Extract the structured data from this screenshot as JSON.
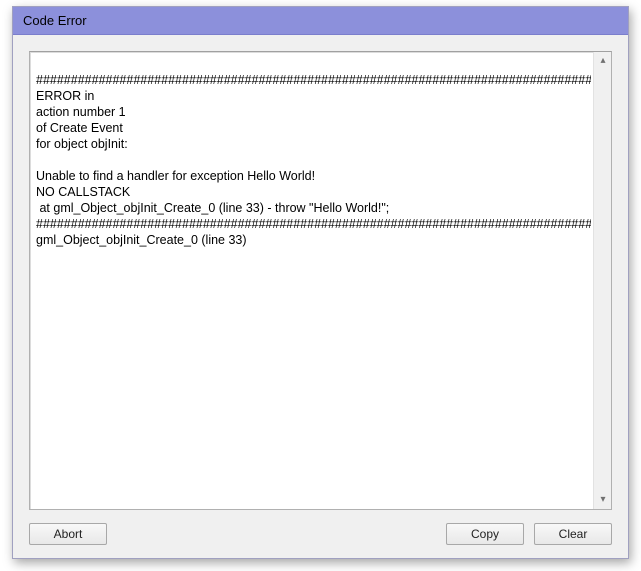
{
  "window": {
    "title": "Code Error"
  },
  "error": {
    "text": "\n############################################################################################\nERROR in\naction number 1\nof Create Event\nfor object objInit:\n\nUnable to find a handler for exception Hello World!\nNO CALLSTACK\n at gml_Object_objInit_Create_0 (line 33) - throw \"Hello World!\";\n############################################################################################\ngml_Object_objInit_Create_0 (line 33)"
  },
  "buttons": {
    "abort": "Abort",
    "copy": "Copy",
    "clear": "Clear"
  },
  "scroll": {
    "up_glyph": "▴",
    "down_glyph": "▾"
  }
}
